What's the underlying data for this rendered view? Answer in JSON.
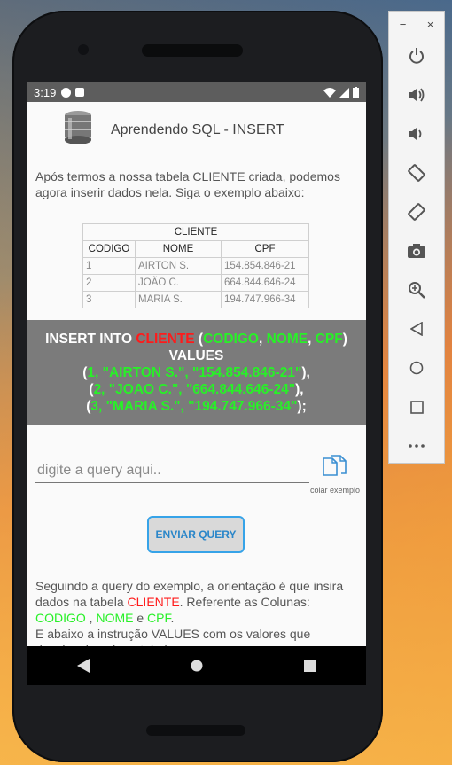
{
  "status": {
    "time": "3:19"
  },
  "app": {
    "title": "Aprendendo SQL - INSERT"
  },
  "intro": "Após termos a nossa tabela CLIENTE criada, podemos agora inserir dados nela. Siga o exemplo abaixo:",
  "table": {
    "caption": "CLIENTE",
    "columns": [
      "CODIGO",
      "NOME",
      "CPF"
    ],
    "rows": [
      [
        "1",
        "AIRTON S.",
        "154.854.846-21"
      ],
      [
        "2",
        "JOÃO C.",
        "664.844.646-24"
      ],
      [
        "3",
        "MARIA S.",
        "194.747.966-34"
      ]
    ]
  },
  "code": {
    "insert_into": "INSERT INTO ",
    "table_name": "CLIENTE",
    "open": " (",
    "col1": "CODIGO",
    "sep1": ", ",
    "col2": "NOME",
    "sep2": ", ",
    "col3": "CPF",
    "close": ")",
    "values": "VALUES",
    "r1_open": "(",
    "r1_v1": "1, \"AIRTON S.\", \"154.854.846-21\"",
    "r1_close": "),",
    "r2_open": "(",
    "r2_v1": "2, \"JOAO C.\", \"664.844.646-24\"",
    "r2_close": "),",
    "r3_open": "(",
    "r3_v1": "3, \"MARIA S.\", \"194.747.966-34\"",
    "r3_close": ");"
  },
  "query": {
    "placeholder": "digite a query aqui.."
  },
  "paste": {
    "label": "colar exemplo"
  },
  "send": {
    "label": "ENVIAR QUERY"
  },
  "explain": {
    "p1": "Seguindo a query do exemplo, a orientação é que insira dados na tabela ",
    "table_name": "CLIENTE",
    "p2": ". Referente as Colunas: ",
    "c1": "CODIGO",
    "s1": " , ",
    "c2": "NOME",
    "s2": " e ",
    "c3": "CPF",
    "s3": ".",
    "p3": "E abaixo a instrução VALUES com os valores que desejam inserir na tabela."
  },
  "colors": {
    "accent": "#36a3e8",
    "code_green": "#28f028",
    "code_red": "#ff1a1a",
    "code_bg": "#7b7b7b"
  },
  "emulator_panel": {
    "window_controls": [
      "−",
      "×"
    ],
    "tools": [
      "power-icon",
      "volume-up-icon",
      "volume-down-icon",
      "rotate-left-icon",
      "rotate-right-icon",
      "camera-icon",
      "zoom-icon",
      "back-icon",
      "home-icon",
      "overview-icon",
      "more-icon"
    ]
  }
}
